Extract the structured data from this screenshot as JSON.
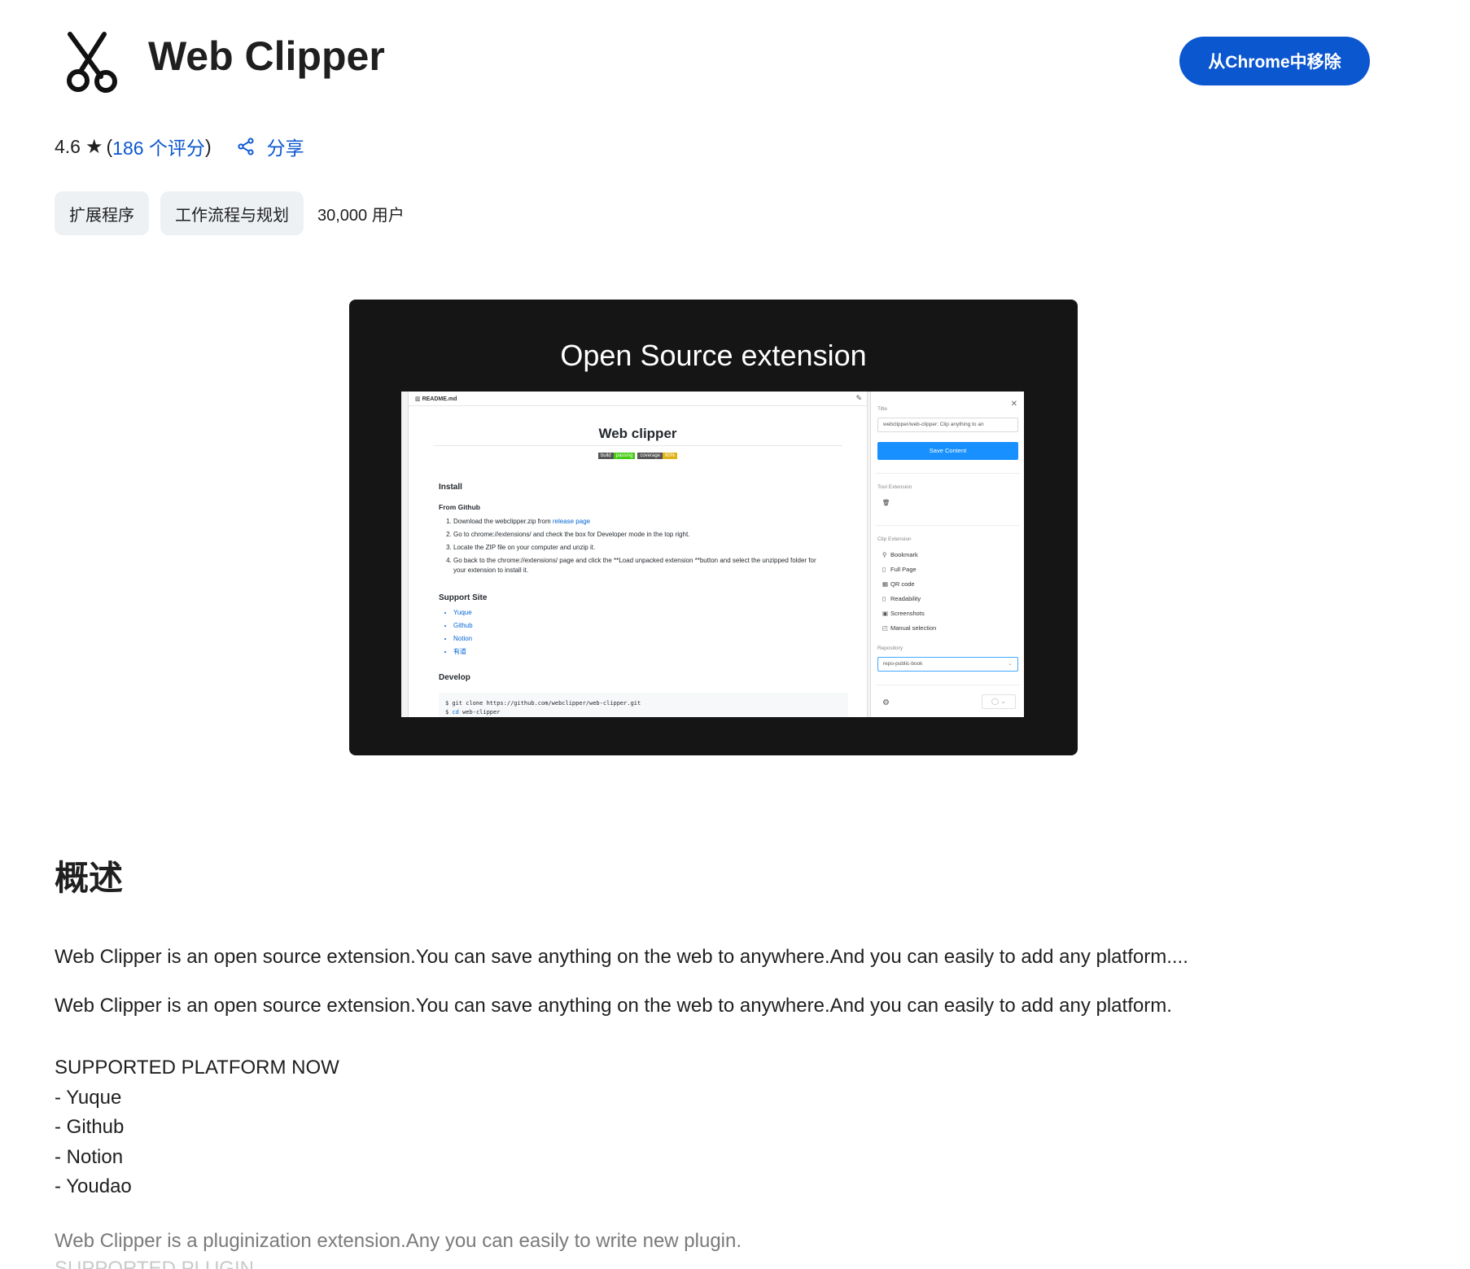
{
  "header": {
    "title": "Web Clipper",
    "remove_button": "从Chrome中移除"
  },
  "rating": {
    "value": "4.6",
    "open_paren": "(",
    "reviews": "186 个评分",
    "close_paren": ")",
    "share_label": "分享"
  },
  "chips": [
    "扩展程序",
    "工作流程与规划"
  ],
  "users": "30,000 用户",
  "screenshot": {
    "title": "Open Source extension",
    "readme": {
      "file": "README.md",
      "heading": "Web clipper",
      "badge_build": "build",
      "badge_passing": "passing",
      "badge_coverage": "coverage",
      "badge_pct": "60%",
      "install": "Install",
      "from_github": "From Github",
      "step1_a": "Download the webclipper.zip from ",
      "step1_link": "release page",
      "step2": "Go to chrome://extensions/ and check the box for Developer mode in the top right.",
      "step3": "Locate the ZIP file on your computer and unzip it.",
      "step4": "Go back to the chrome://extensions/ page and click the **Load unpacked extension **button and select the unzipped folder for your extension to install it.",
      "support_site": "Support Site",
      "sites": [
        "Yuque",
        "Github",
        "Notion",
        "有道"
      ],
      "develop": "Develop",
      "code1": "$ git clone https://github.com/webclipper/web-clipper.git",
      "code2_prefix": "$ ",
      "code2_kw": "cd",
      "code2_rest": " web-clipper"
    },
    "panel": {
      "title_label": "Title",
      "title_value": "webclipper/web-clipper: Clip anything to an",
      "save_button": "Save Content",
      "tool_extension": "Tool Extension",
      "clip_extension": "Clip Extension",
      "clip_items": [
        "Bookmark",
        "Full Page",
        "QR code",
        "Readability",
        "Screenshots",
        "Manual selection"
      ],
      "repository_label": "Repository",
      "repository_value": "repo-public-book"
    }
  },
  "overview": {
    "heading": "概述",
    "para1": "Web Clipper is an open source extension.You can save anything on the web to anywhere.And you can easily to add any platform....",
    "para2": "Web Clipper is an open source extension.You can save anything on the web to anywhere.And you can easily to add any platform.",
    "supported_title": "SUPPORTED PLATFORM NOW",
    "platforms": [
      "- Yuque",
      "- Github",
      "- Notion",
      "- Youdao"
    ],
    "para3": "Web Clipper is a pluginization extension.Any you can easily to write new plugin.",
    "cut_line": "SUPPORTED PLUGIN"
  }
}
